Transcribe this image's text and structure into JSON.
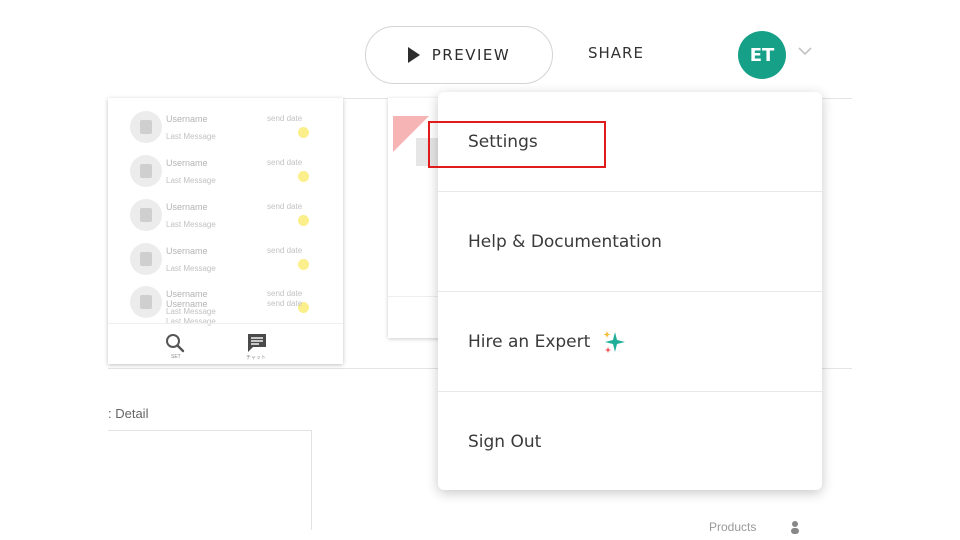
{
  "header": {
    "preview_label": "PREVIEW",
    "share_label": "SHARE",
    "avatar_initials": "ET",
    "avatar_color": "#16a088"
  },
  "chat_list": {
    "rows": [
      {
        "username": "Username",
        "message": "Last Message",
        "date": "send date"
      },
      {
        "username": "Username",
        "message": "Last Message",
        "date": "send date"
      },
      {
        "username": "Username",
        "message": "Last Message",
        "date": "send date"
      },
      {
        "username": "Username",
        "message": "Last Message",
        "date": "send date"
      },
      {
        "username": "Username",
        "message": "Last Message",
        "date": "send date"
      },
      {
        "username": "Username",
        "message": "Last Message",
        "date": "send date"
      }
    ],
    "unread_dot_color": "#fbef8b",
    "tabs": [
      {
        "icon": "search-icon",
        "caption": "SET"
      },
      {
        "icon": "chat-icon",
        "caption": "チャット"
      }
    ]
  },
  "canvas": {
    "detail_label": ": Detail",
    "products_label": "Products"
  },
  "dropdown": {
    "items": [
      {
        "label": "Settings"
      },
      {
        "label": "Help & Documentation"
      },
      {
        "label": "Hire an Expert",
        "icon": "sparkle-icon"
      },
      {
        "label": "Sign Out"
      }
    ],
    "highlight_color": "#e01b1b"
  }
}
